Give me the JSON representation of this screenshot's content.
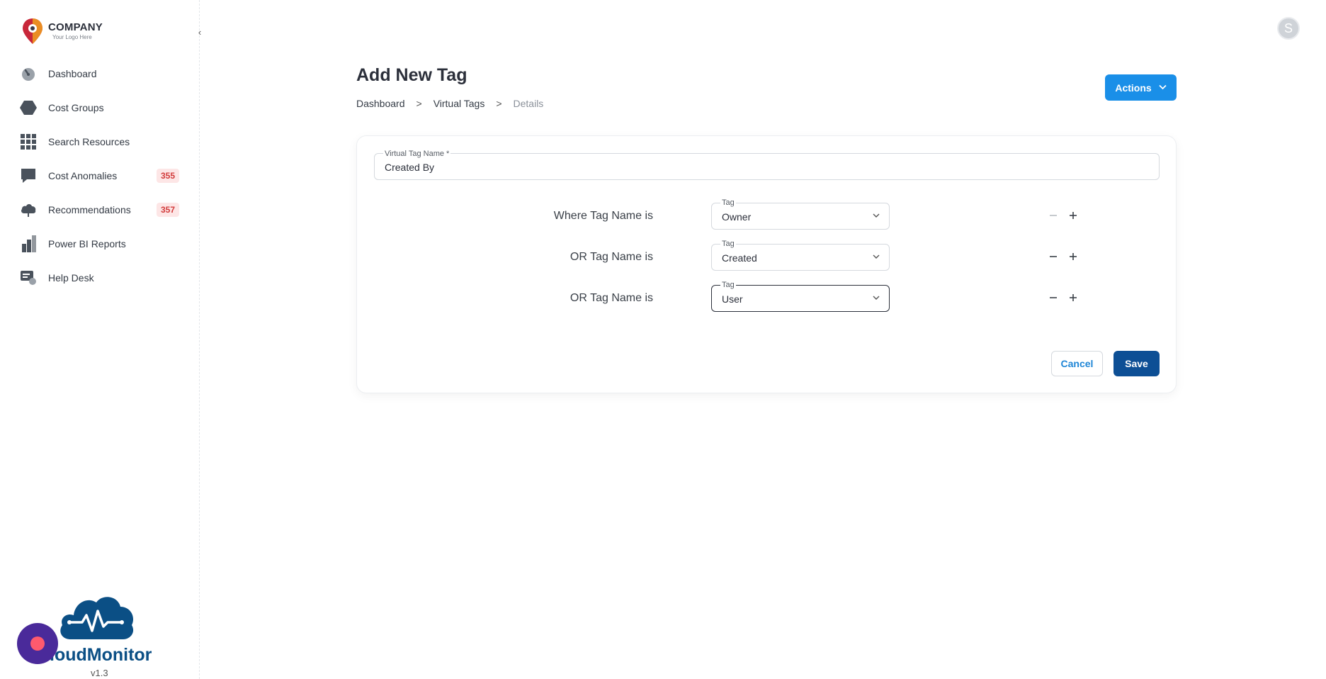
{
  "logo": {
    "name": "COMPANY",
    "tagline": "Your Logo Here"
  },
  "sidebar": {
    "items": [
      {
        "label": "Dashboard",
        "icon": "gauge-icon"
      },
      {
        "label": "Cost Groups",
        "icon": "hexagon-icon"
      },
      {
        "label": "Search Resources",
        "icon": "grid-icon"
      },
      {
        "label": "Cost Anomalies",
        "icon": "chat-icon",
        "badge": "355"
      },
      {
        "label": "Recommendations",
        "icon": "cloud-icon",
        "badge": "357"
      },
      {
        "label": "Power BI Reports",
        "icon": "bar-chart-icon"
      },
      {
        "label": "Help Desk",
        "icon": "help-desk-icon"
      }
    ],
    "brand": "loudMonitor",
    "version": "v1.3"
  },
  "user": {
    "initial": "S"
  },
  "header": {
    "title": "Add New Tag",
    "breadcrumb": [
      "Dashboard",
      "Virtual Tags",
      "Details"
    ],
    "separator": ">",
    "actions_label": "Actions"
  },
  "form": {
    "name_label": "Virtual Tag Name *",
    "name_value": "Created By",
    "rows": [
      {
        "label": "Where Tag Name is",
        "field_label": "Tag",
        "value": "Owner"
      },
      {
        "label": "OR Tag Name is",
        "field_label": "Tag",
        "value": "Created"
      },
      {
        "label": "OR Tag Name is",
        "field_label": "Tag",
        "value": "User"
      }
    ],
    "cancel_label": "Cancel",
    "save_label": "Save"
  },
  "colors": {
    "primary": "#1a8fe8",
    "save": "#0d4f95",
    "badge_bg": "#fde6e6",
    "badge_text": "#d23b3b",
    "brand": "#0b4f85",
    "fab": "#4a2a9a"
  }
}
